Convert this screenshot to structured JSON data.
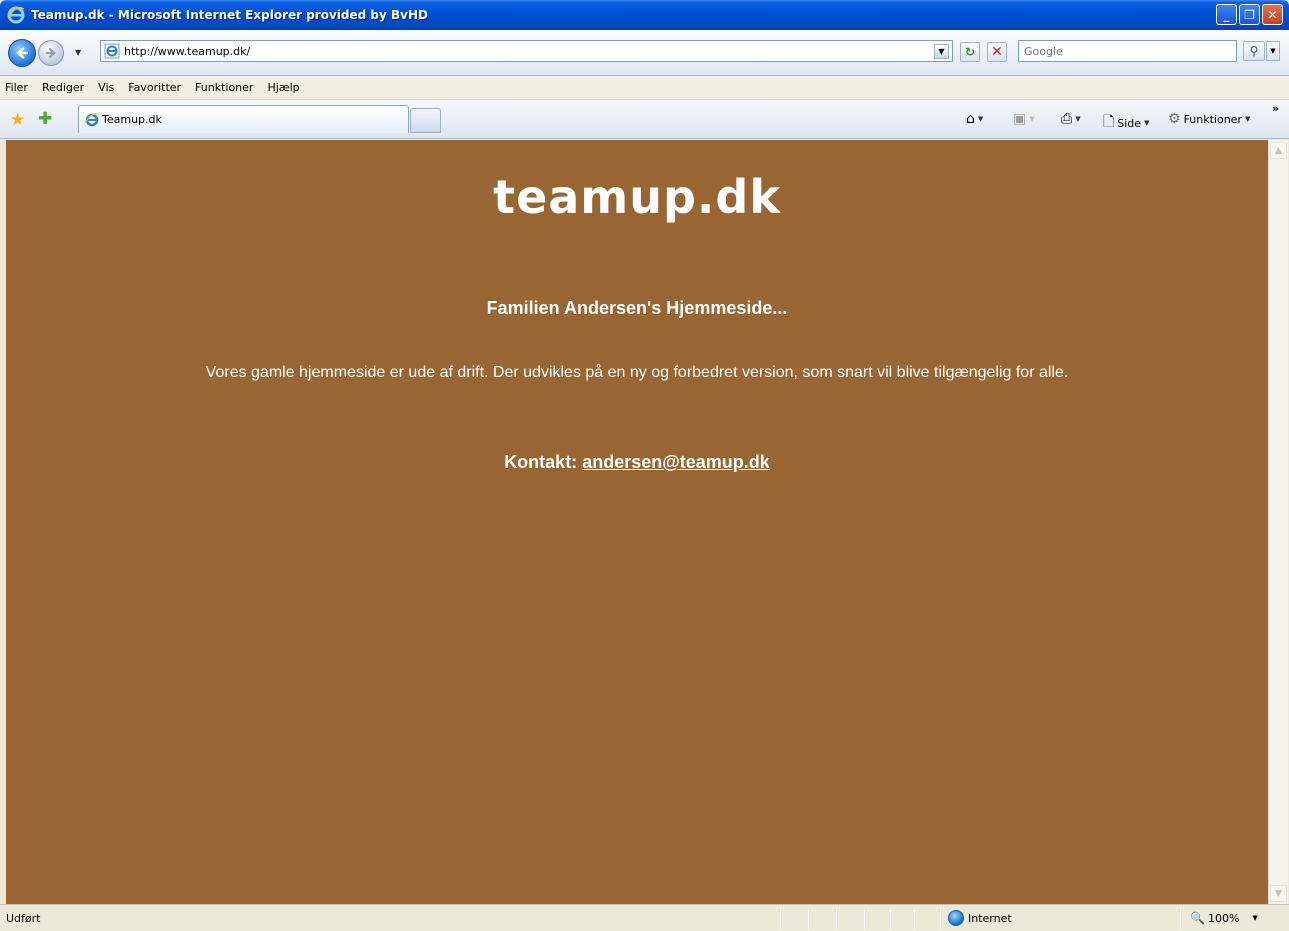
{
  "window": {
    "title": "Teamup.dk - Microsoft Internet Explorer provided by BvHD",
    "controls": {
      "minimize": "_",
      "restore": "❐",
      "close": "✕"
    }
  },
  "addressbar": {
    "url": "http://www.teamup.dk/",
    "search_placeholder": "Google"
  },
  "menu": {
    "items": [
      "Filer",
      "Rediger",
      "Vis",
      "Favoritter",
      "Funktioner",
      "Hjælp"
    ]
  },
  "tabs": [
    {
      "label": "Teamup.dk",
      "active": true
    }
  ],
  "commandbar": {
    "side_label": "Side",
    "tools_label": "Funktioner",
    "chevron": "»"
  },
  "page": {
    "background": "#996633",
    "site_title": "teamup.dk",
    "subtitle": "Familien Andersen's Hjemmeside...",
    "notice": "Vores gamle hjemmeside er ude af drift. Der udvikles på en ny og forbedret version, som snart vil blive tilgængelig for alle.",
    "contact_label": "Kontakt:",
    "contact_email": "andersen@teamup.dk"
  },
  "statusbar": {
    "status_text": "Udført",
    "zone": "Internet",
    "zoom": "100%"
  }
}
